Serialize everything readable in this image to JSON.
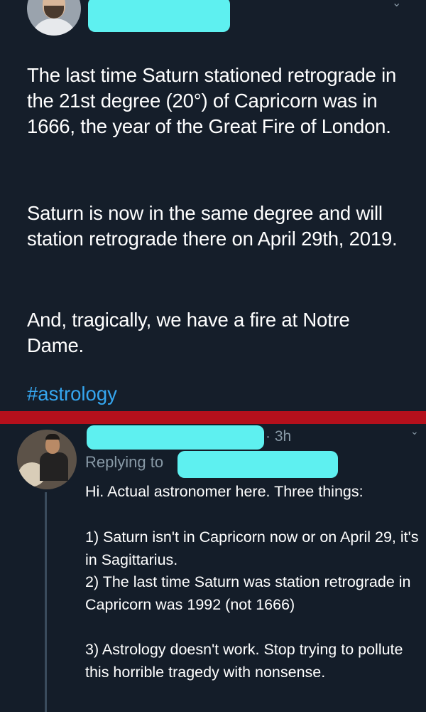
{
  "original_tweet": {
    "text_paragraphs": [
      "The last time Saturn stationed retrograde in the 21st degree (20°) of Capricorn was in 1666, the year of the Great Fire of London.",
      "Saturn is now in the same degree and will station retrograde there on April 29th, 2019.",
      "And, tragically, we have a fire at Notre Dame."
    ],
    "hashtag": "#astrology"
  },
  "reply_tweet": {
    "time": "· 3h",
    "replying_to_label": "Replying to",
    "lines": [
      "Hi. Actual astronomer here. Three things:",
      "1) Saturn isn't in Capricorn now or on April 29, it's in Sagittarius.",
      "2) The last time Saturn was station retrograde in Capricorn was 1992 (not 1666)",
      "3) Astrology doesn't work. Stop trying to pollute this horrible tragedy with nonsense."
    ]
  },
  "colors": {
    "background": "#141d29",
    "redaction": "#5ef0f0",
    "hashtag": "#35a6ef",
    "divider": "#b5101c",
    "muted_text": "#8899a6"
  },
  "icons": {
    "tweet_menu": "chevron-down-icon"
  }
}
